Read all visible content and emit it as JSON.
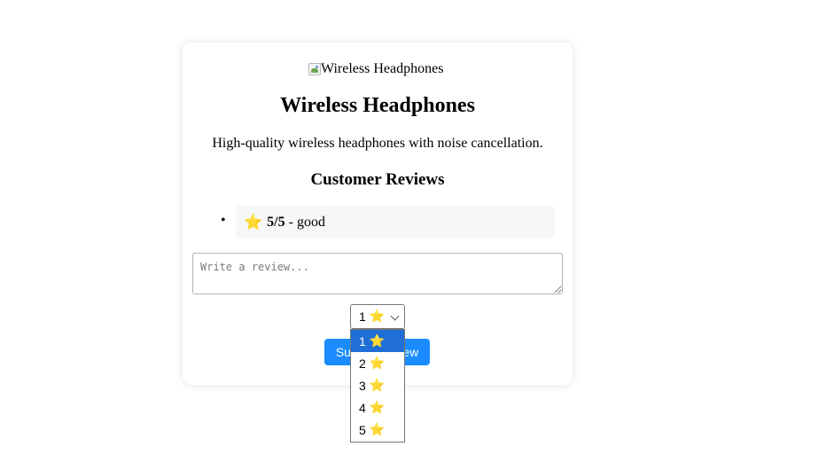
{
  "product": {
    "image_alt": "Wireless Headphones",
    "title": "Wireless Headphones",
    "description": "High-quality wireless headphones with noise cancellation."
  },
  "reviews": {
    "heading": "Customer Reviews",
    "items": [
      {
        "star": "⭐",
        "rating": "5/5",
        "text": " - good"
      }
    ]
  },
  "review_form": {
    "placeholder": "Write a review...",
    "rating_value": "1",
    "rating_star": "⭐",
    "submit_label": "Submit Review"
  },
  "rating_dropdown": {
    "options": [
      {
        "value": "1",
        "star": "⭐",
        "selected": true
      },
      {
        "value": "2",
        "star": "⭐"
      },
      {
        "value": "3",
        "star": "⭐"
      },
      {
        "value": "4",
        "star": "⭐"
      },
      {
        "value": "5",
        "star": "⭐"
      }
    ]
  },
  "colors": {
    "accent": "#1a8cff",
    "selected_option": "#1f6fd6",
    "review_bg": "#f6f7f9"
  }
}
